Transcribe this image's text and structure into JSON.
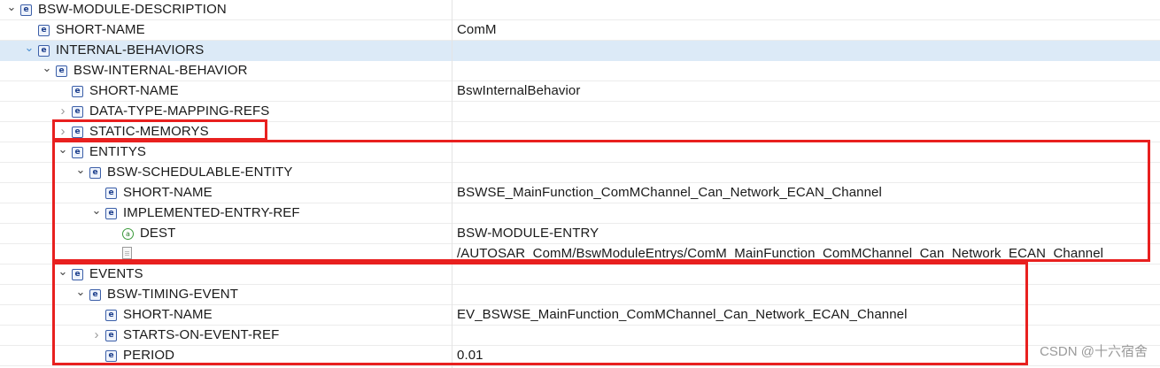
{
  "tree": {
    "rows": [
      {
        "label": "BSW-MODULE-DESCRIPTION",
        "value": "",
        "icon": "element-icon",
        "toggle": "expanded"
      },
      {
        "label": "SHORT-NAME",
        "value": "ComM",
        "icon": "element-icon",
        "toggle": "none"
      },
      {
        "label": "INTERNAL-BEHAVIORS",
        "value": "",
        "icon": "element-icon",
        "toggle": "expanded",
        "selected": true
      },
      {
        "label": "BSW-INTERNAL-BEHAVIOR",
        "value": "",
        "icon": "element-icon",
        "toggle": "expanded"
      },
      {
        "label": "SHORT-NAME",
        "value": "BswInternalBehavior",
        "icon": "element-icon",
        "toggle": "none"
      },
      {
        "label": "DATA-TYPE-MAPPING-REFS",
        "value": "",
        "icon": "element-icon",
        "toggle": "collapsed"
      },
      {
        "label": "STATIC-MEMORYS",
        "value": "",
        "icon": "element-icon",
        "toggle": "collapsed"
      },
      {
        "label": "ENTITYS",
        "value": "",
        "icon": "element-icon",
        "toggle": "expanded"
      },
      {
        "label": "BSW-SCHEDULABLE-ENTITY",
        "value": "",
        "icon": "element-icon",
        "toggle": "expanded"
      },
      {
        "label": "SHORT-NAME",
        "value": "BSWSE_MainFunction_ComMChannel_Can_Network_ECAN_Channel",
        "icon": "element-icon",
        "toggle": "none"
      },
      {
        "label": "IMPLEMENTED-ENTRY-REF",
        "value": "",
        "icon": "element-icon",
        "toggle": "expanded"
      },
      {
        "label": "DEST",
        "value": "BSW-MODULE-ENTRY",
        "icon": "attribute-icon",
        "toggle": "none"
      },
      {
        "label": "",
        "value": "/AUTOSAR_ComM/BswModuleEntrys/ComM_MainFunction_ComMChannel_Can_Network_ECAN_Channel",
        "icon": "text-node-icon",
        "toggle": "none"
      },
      {
        "label": "EVENTS",
        "value": "",
        "icon": "element-icon",
        "toggle": "expanded"
      },
      {
        "label": "BSW-TIMING-EVENT",
        "value": "",
        "icon": "element-icon",
        "toggle": "expanded"
      },
      {
        "label": "SHORT-NAME",
        "value": "EV_BSWSE_MainFunction_ComMChannel_Can_Network_ECAN_Channel",
        "icon": "element-icon",
        "toggle": "none"
      },
      {
        "label": "STARTS-ON-EVENT-REF",
        "value": "",
        "icon": "element-icon",
        "toggle": "collapsed"
      },
      {
        "label": "PERIOD",
        "value": "0.01",
        "icon": "element-icon",
        "toggle": "none"
      }
    ]
  },
  "icons": {
    "element": "e",
    "attribute": "a"
  },
  "colors": {
    "highlight": "#e8201f",
    "selection": "#dceaf7",
    "element_icon": "#3c5fa8"
  },
  "watermark": "CSDN @十六宿舍"
}
